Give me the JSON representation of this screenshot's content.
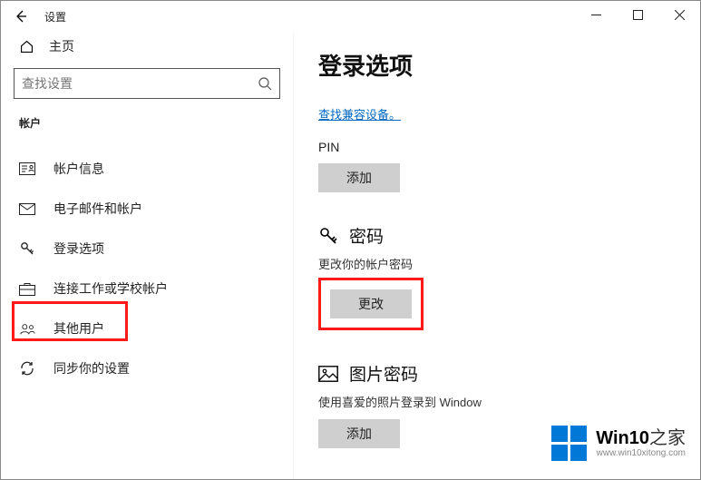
{
  "titlebar": {
    "app_name": "设置"
  },
  "sidebar": {
    "home": "主页",
    "search_placeholder": "查找设置",
    "category": "帐户",
    "items": [
      {
        "label": "帐户信息"
      },
      {
        "label": "电子邮件和帐户"
      },
      {
        "label": "登录选项"
      },
      {
        "label": "连接工作或学校帐户"
      },
      {
        "label": "其他用户"
      },
      {
        "label": "同步你的设置"
      }
    ]
  },
  "content": {
    "title": "登录选项",
    "compat_link": "查找兼容设备。",
    "pin": {
      "label": "PIN",
      "button": "添加"
    },
    "password": {
      "title": "密码",
      "subtitle": "更改你的帐户密码",
      "button": "更改"
    },
    "picture": {
      "title": "图片密码",
      "subtitle": "使用喜爱的照片登录到 Window",
      "button": "添加"
    }
  },
  "watermark": {
    "brand_a": "Win10",
    "brand_b": "之家",
    "url": "www.win10xitong.com"
  }
}
